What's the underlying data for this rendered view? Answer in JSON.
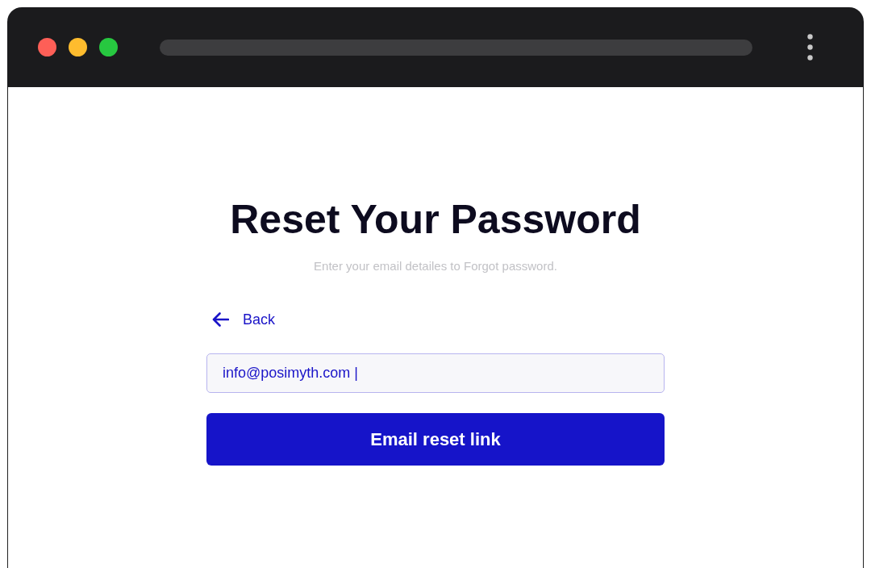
{
  "browser": {
    "window_controls": [
      {
        "color": "#fe5f57"
      },
      {
        "color": "#febc2e"
      },
      {
        "color": "#27c840"
      }
    ]
  },
  "form": {
    "title": "Reset Your Password",
    "subtitle": "Enter your email detailes to Forgot password.",
    "back_link": {
      "label": "Back"
    },
    "email_field": {
      "value": "info@posimyth.com |"
    },
    "submit_button": {
      "label": "Email reset link"
    }
  }
}
